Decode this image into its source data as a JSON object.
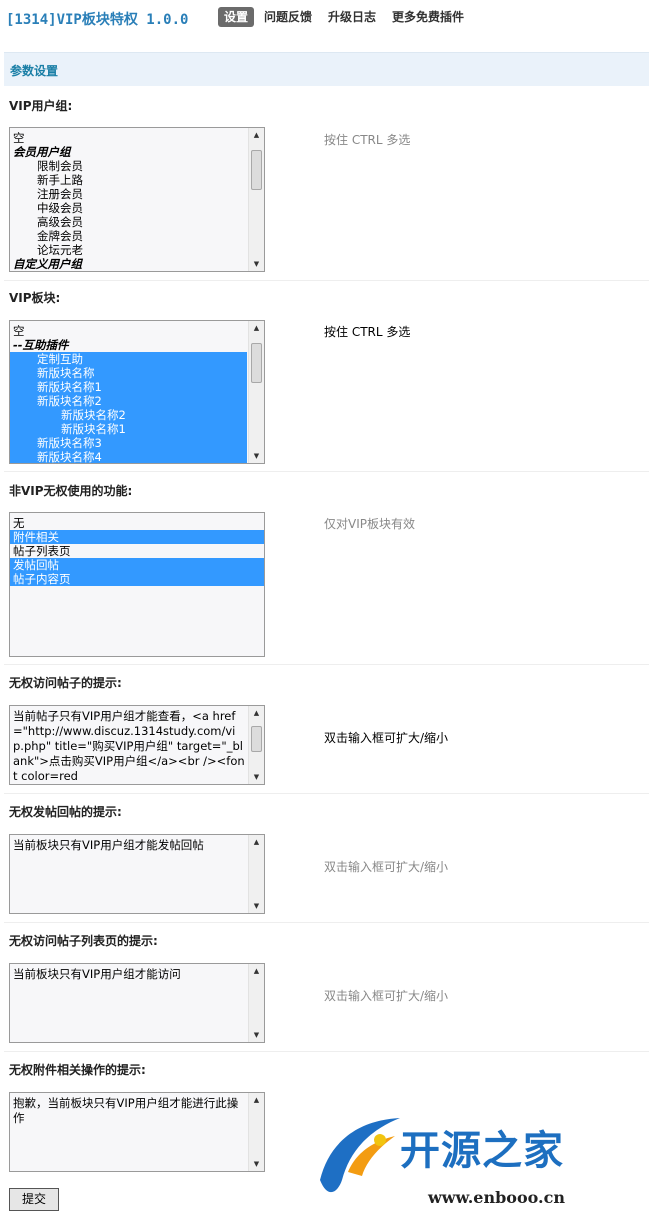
{
  "header": {
    "app_title": "[1314]VIP板块特权 1.0.0",
    "nav": [
      "设置",
      "问题反馈",
      "升级日志",
      "更多免费插件"
    ],
    "active_nav": "设置"
  },
  "section": {
    "title": "参数设置"
  },
  "fields": {
    "vip_groups": {
      "label": "VIP用户组:",
      "hint": "按住 CTRL 多选",
      "options": [
        "空",
        "会员用户组",
        "限制会员",
        "新手上路",
        "注册会员",
        "中级会员",
        "高级会员",
        "金牌会员",
        "论坛元老",
        "自定义用户组"
      ]
    },
    "vip_forums": {
      "label": "VIP板块:",
      "hint": "按住 CTRL 多选",
      "options": [
        "空",
        "--互助插件",
        "定制互助",
        "新版块名称",
        "新版块名称1",
        "新版块名称2",
        "新版块名称2",
        "新版块名称1",
        "新版块名称3",
        "新版块名称4"
      ]
    },
    "nonvip_functions": {
      "label": "非VIP无权使用的功能:",
      "hint": "仅对VIP板块有效",
      "options": [
        "无",
        "附件相关",
        "帖子列表页",
        "发帖回帖",
        "帖子内容页"
      ]
    },
    "no_view_tip": {
      "label": "无权访问帖子的提示:",
      "hint": "双击输入框可扩大/缩小",
      "value": "当前帖子只有VIP用户组才能查看，<a href=\"http://www.discuz.1314study.com/vip.php\" title=\"购买VIP用户组\" target=\"_blank\">点击购买VIP用户组</a><br /><font color=red"
    },
    "no_post_tip": {
      "label": "无权发帖回帖的提示:",
      "hint": "双击输入框可扩大/缩小",
      "value": "当前板块只有VIP用户组才能发帖回帖"
    },
    "no_list_tip": {
      "label": "无权访问帖子列表页的提示:",
      "hint": "双击输入框可扩大/缩小",
      "value": "当前板块只有VIP用户组才能访问"
    },
    "no_attach_tip": {
      "label": "无权附件相关操作的提示:",
      "value": "抱歉，当前板块只有VIP用户组才能进行此操作"
    }
  },
  "submit_label": "提交",
  "watermark": {
    "name": "开源之家",
    "url": "www.enbooo.cn"
  },
  "colors": {
    "accent": "#1a7fa6",
    "selection": "#3399ff",
    "header_bg": "#eaf2fa"
  }
}
